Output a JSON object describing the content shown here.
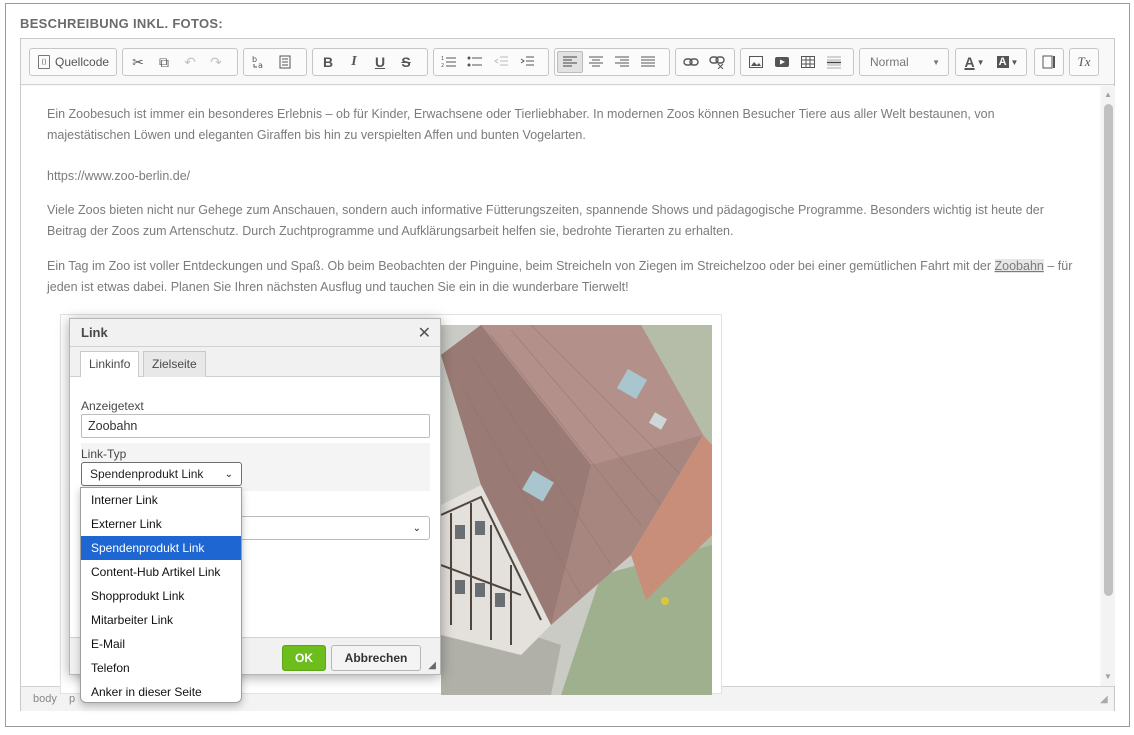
{
  "section_title": "BESCHREIBUNG INKL. FOTOS:",
  "toolbar": {
    "source_label": "Quellcode",
    "format_value": "Normal",
    "buttons": {
      "cut": "✂",
      "copy": "⧉",
      "undo": "↶",
      "redo": "↷",
      "bold": "B",
      "italic": "I",
      "underline": "U",
      "strike": "S",
      "text_color": "A",
      "bg_color": "A",
      "clear_format": "Tx"
    }
  },
  "content": {
    "p1": "Ein Zoobesuch ist immer ein besonderes Erlebnis – ob für Kinder, Erwachsene oder Tierliebhaber. In modernen Zoos können Besucher Tiere aus aller Welt bestaunen, von majestätischen Löwen und eleganten Giraffen bis hin zu verspielten Affen und bunten Vogelarten.",
    "url": "https://www.zoo-berlin.de/",
    "p2": "Viele Zoos bieten nicht nur Gehege zum Anschauen, sondern auch informative Fütterungszeiten, spannende Shows und pädagogische Programme. Besonders wichtig ist heute der Beitrag der Zoos zum Artenschutz. Durch Zuchtprogramme und Aufklärungsarbeit helfen sie, bedrohte Tierarten zu erhalten.",
    "p3_before": "Ein Tag im Zoo ist voller Entdeckungen und Spaß. Ob beim Beobachten der Pinguine, beim Streicheln von Ziegen im Streichelzoo oder bei einer gemütlichen Fahrt mit der ",
    "p3_link": "Zoobahn",
    "p3_after": " – für jeden ist etwas dabei. Planen Sie Ihren nächsten Ausflug und tauchen Sie ein in die wunderbare Tierwelt!"
  },
  "statusbar": {
    "crumb1": "body",
    "crumb2": "p"
  },
  "dialog": {
    "title": "Link",
    "close": "✕",
    "tabs": [
      "Linkinfo",
      "Zielseite"
    ],
    "display_text_label": "Anzeigetext",
    "display_text_value": "Zoobahn",
    "link_type_label": "Link-Typ",
    "link_type_value": "Spendenprodukt Link",
    "ok_label": "OK",
    "cancel_label": "Abbrechen"
  },
  "dropdown": {
    "options": [
      "Interner Link",
      "Externer Link",
      "Spendenprodukt Link",
      "Content-Hub Artikel Link",
      "Shopprodukt Link",
      "Mitarbeiter Link",
      "E-Mail",
      "Telefon",
      "Anker in dieser Seite"
    ],
    "selected_index": 2
  },
  "colors": {
    "ok_green": "#6dbd1c",
    "selected_blue": "#1e66d1",
    "text_grey": "#7b7b7b"
  }
}
